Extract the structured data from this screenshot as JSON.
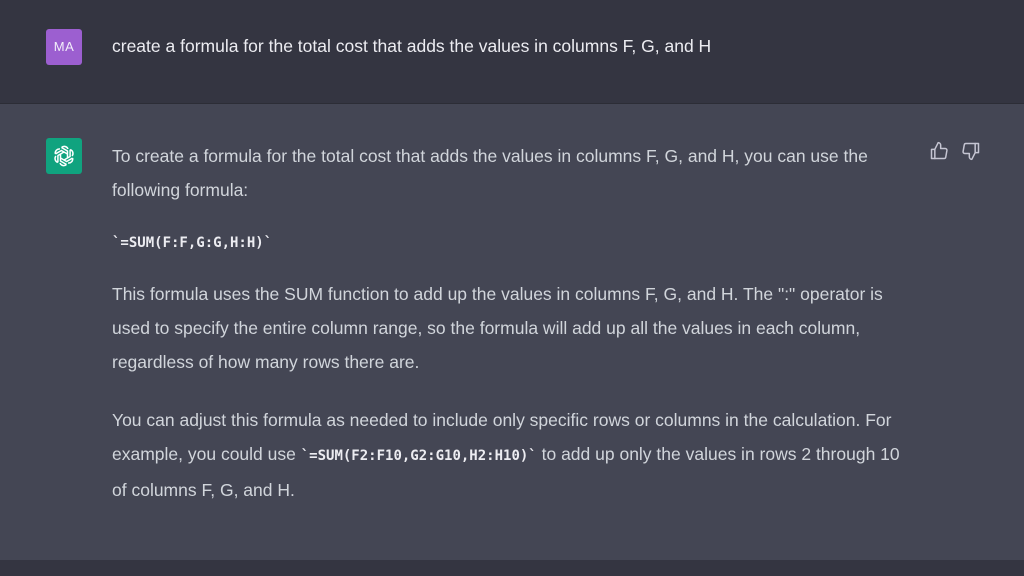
{
  "user_message": {
    "avatar_initials": "MA",
    "text": "create a formula for the total cost that adds the values in columns F, G, and H"
  },
  "assistant_message": {
    "paragraph_1": "To create a formula for the total cost that adds the values in columns F, G, and H, you can use the following formula:",
    "code_block": "`=SUM(F:F,G:G,H:H)`",
    "paragraph_2": "This formula uses the SUM function to add up the values in columns F, G, and H. The \":\" operator is used to specify the entire column range, so the formula will add up all the values in each column, regardless of how many rows there are.",
    "paragraph_3_before": "You can adjust this formula as needed to include only specific rows or columns in the calculation. For example, you could use ",
    "paragraph_3_code": "`=SUM(F2:F10,G2:G10,H2:H10)`",
    "paragraph_3_after": " to add up only the values in rows 2 through 10 of columns F, G, and H."
  },
  "feedback": {
    "thumbs_up_icon": "thumbs-up-icon",
    "thumbs_down_icon": "thumbs-down-icon"
  },
  "colors": {
    "user_row_bg": "#343541",
    "assistant_row_bg": "#444654",
    "user_avatar": "#9c5fd0",
    "assistant_avatar": "#10a37f",
    "text": "#d1d5db"
  }
}
